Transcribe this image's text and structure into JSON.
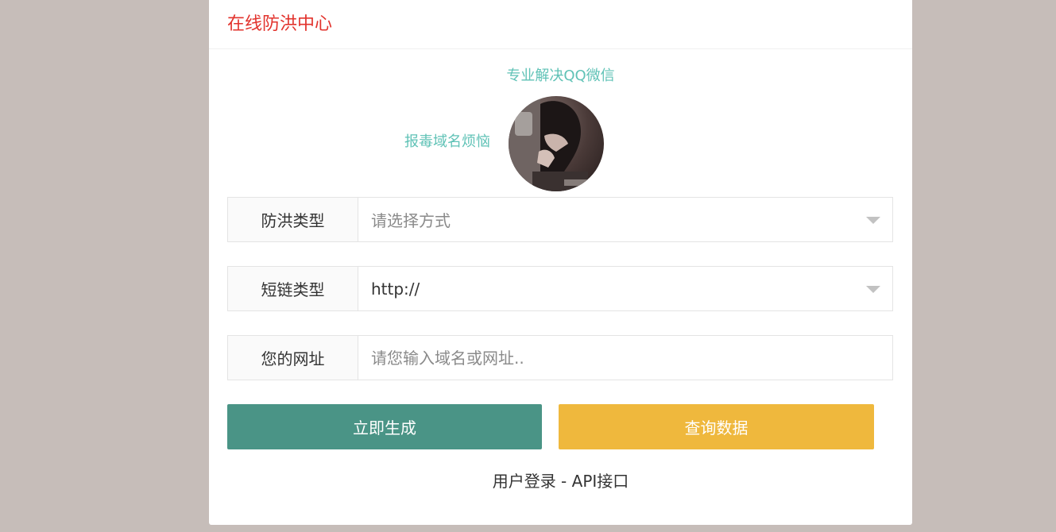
{
  "card": {
    "title": "在线防洪中心"
  },
  "promo": {
    "line_top": "专业解决QQ微信",
    "line_side": "报毒域名烦恼"
  },
  "form": {
    "type_label": "防洪类型",
    "type_placeholder": "请选择方式",
    "short_label": "短链类型",
    "short_value": "http://",
    "url_label": "您的网址",
    "url_placeholder": "请您输入域名或网址.."
  },
  "buttons": {
    "generate": "立即生成",
    "query": "查询数据"
  },
  "footer": {
    "login": "用户登录",
    "separator": " - ",
    "api": "API接口"
  },
  "colors": {
    "page_bg": "#c6bdb9",
    "title": "#e2332d",
    "promo": "#5fc2b6",
    "generate": "#4a9486",
    "query": "#efb83d"
  }
}
